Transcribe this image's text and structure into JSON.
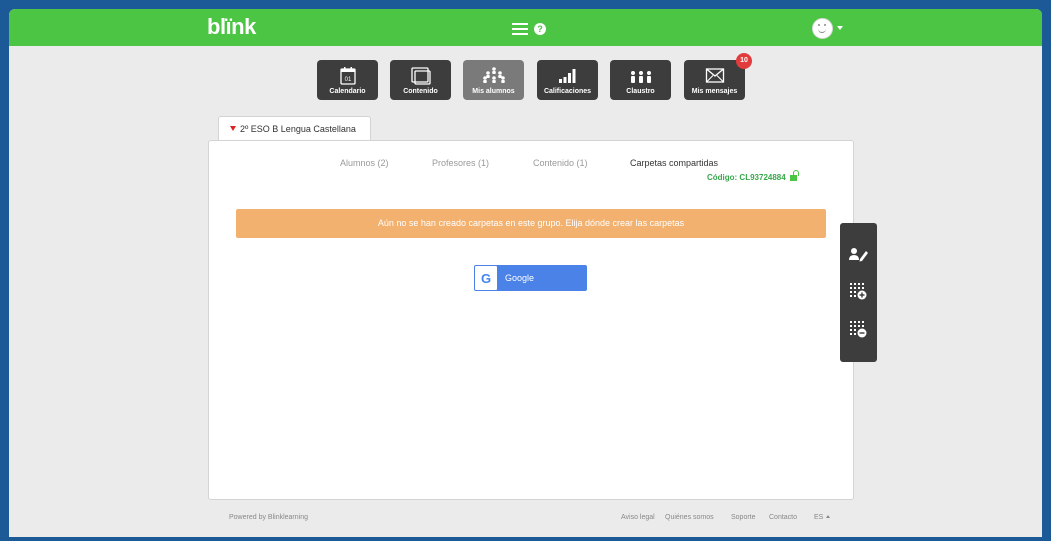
{
  "app": {
    "logo": "blïnk",
    "help_icon": "?"
  },
  "nav": [
    {
      "label": "Calendario",
      "icon": "calendar-icon",
      "icon_text": "01"
    },
    {
      "label": "Contenido",
      "icon": "contents-icon"
    },
    {
      "label": "Mis alumnos",
      "icon": "students-icon",
      "active": true
    },
    {
      "label": "Calificaciones",
      "icon": "grades-icon"
    },
    {
      "label": "Claustro",
      "icon": "staff-icon"
    },
    {
      "label": "Mis mensajes",
      "icon": "messages-icon",
      "badge": "10"
    }
  ],
  "group": {
    "label": "2º ESO B Lengua Castellana"
  },
  "tabs": [
    {
      "label": "Alumnos (2)"
    },
    {
      "label": "Profesores (1)"
    },
    {
      "label": "Contenido (1)"
    },
    {
      "label": "Carpetas compartidas",
      "active": true
    }
  ],
  "code": "Código: CL93724884",
  "alert": "Aún no se han creado carpetas en este grupo. Elija dónde crear las carpetas",
  "google_button": {
    "label": "Google",
    "icon_letter": "G"
  },
  "side_tools": [
    {
      "icon": "edit-user-icon"
    },
    {
      "icon": "grid-add-icon"
    },
    {
      "icon": "grid-remove-icon"
    }
  ],
  "footer": {
    "powered": "Powered by Blinklearning",
    "links": [
      "Aviso legal",
      "Quiénes somos",
      "Soporte",
      "Contacto"
    ],
    "language": "ES"
  },
  "colors": {
    "topbar": "#4cc444",
    "nav_button": "#3d3d3d",
    "nav_active": "#7a7a7a",
    "badge": "#e23b3b",
    "alert": "#f3b16f",
    "google_button": "#4a82e8",
    "code_text": "#37a84a",
    "group_indicator": "#e02121"
  }
}
